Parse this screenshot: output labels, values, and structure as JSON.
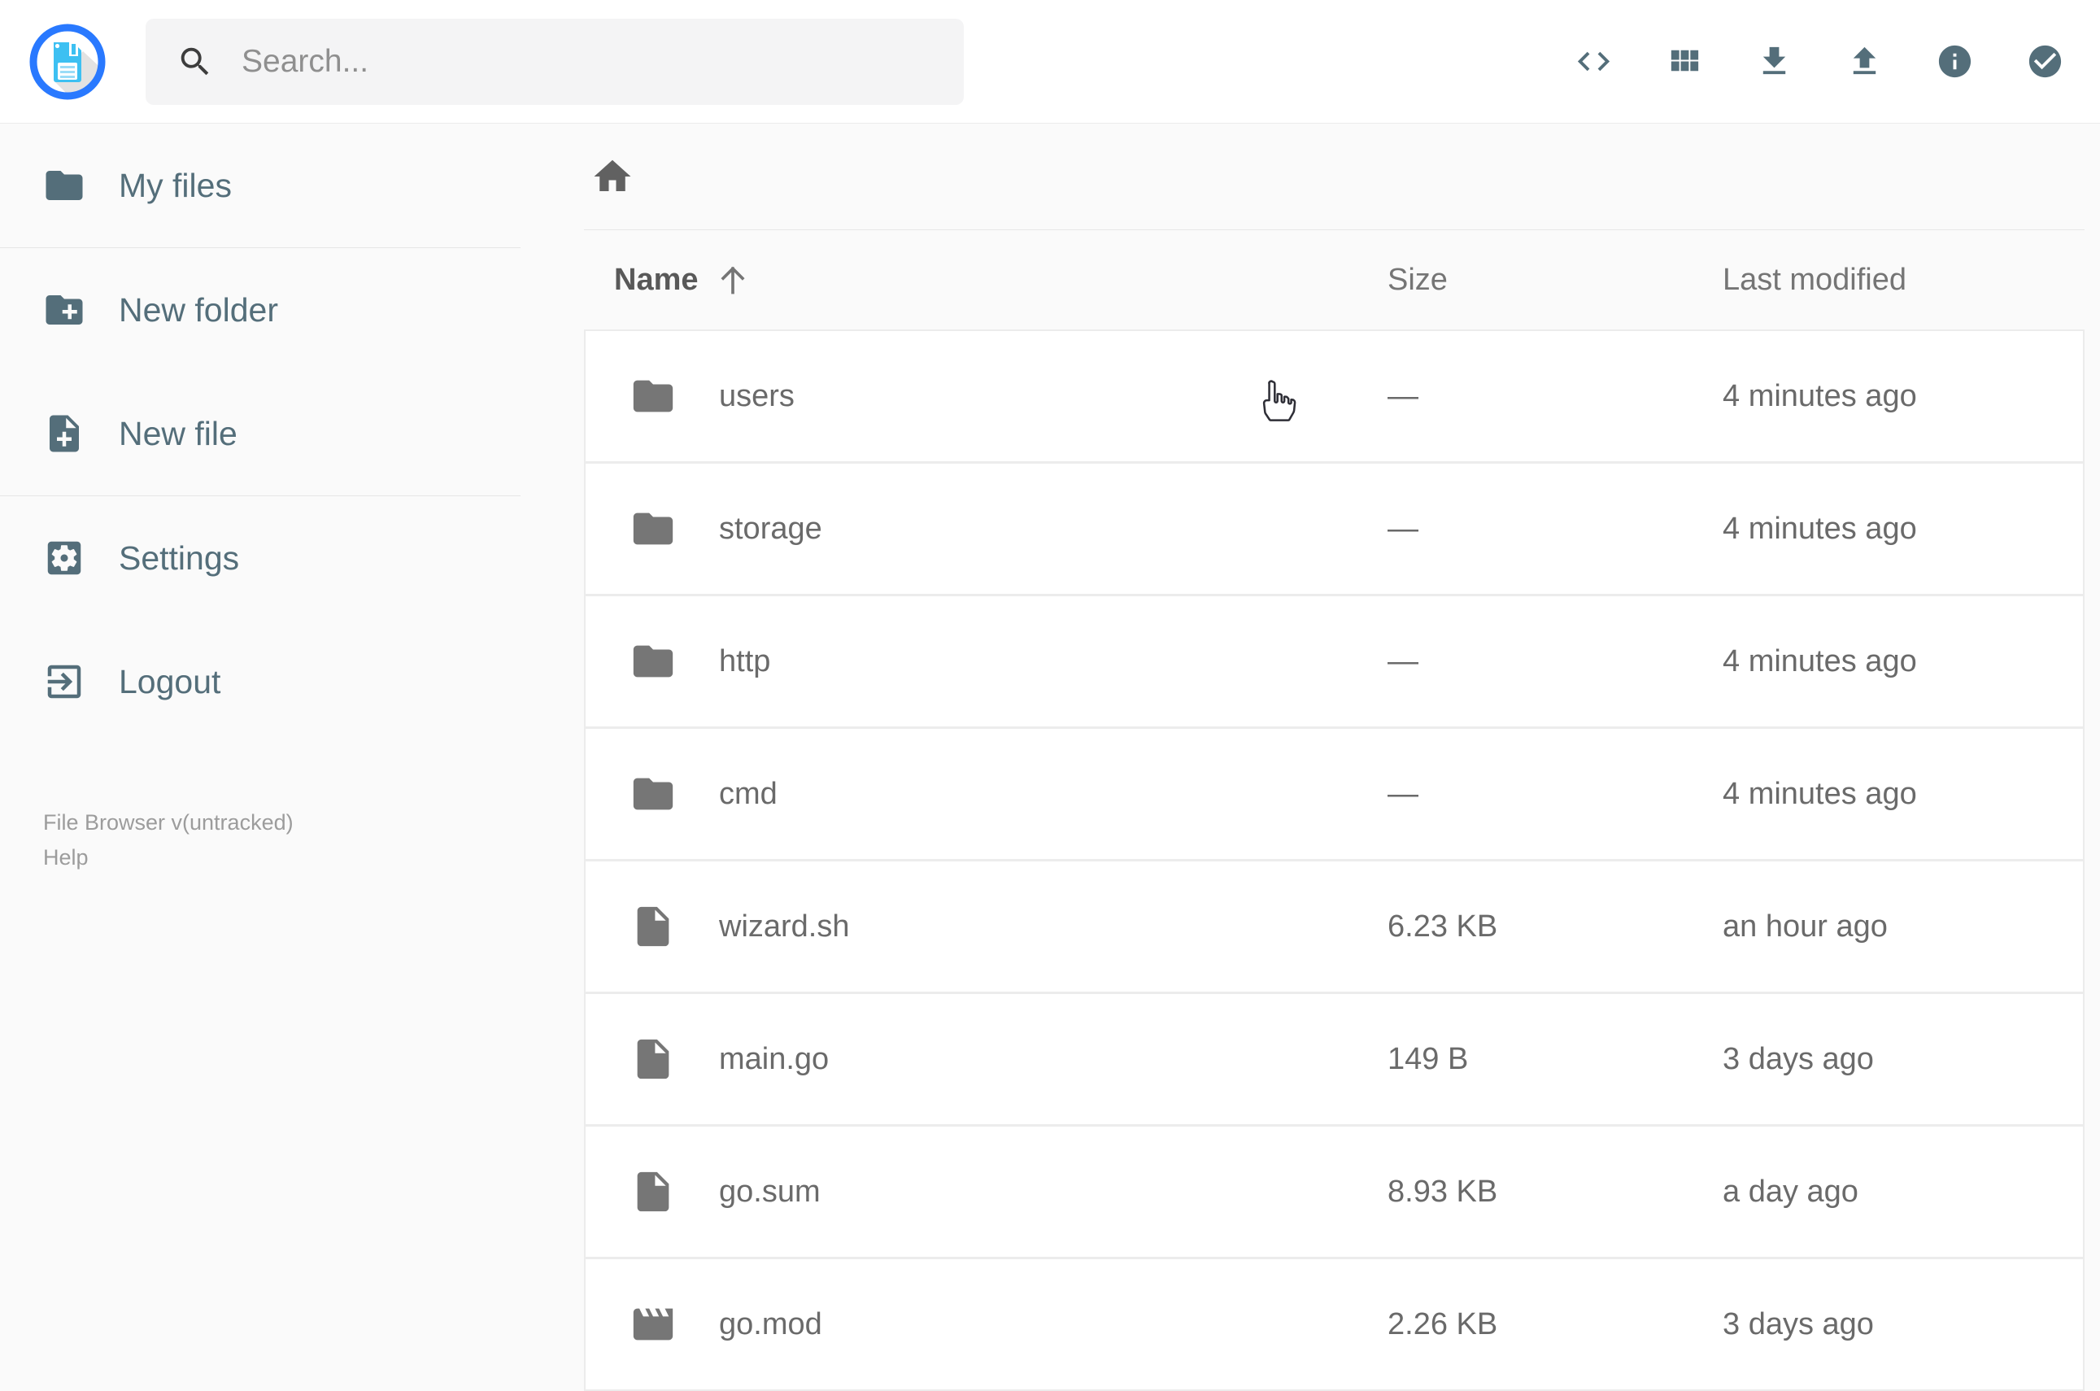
{
  "header": {
    "search_placeholder": "Search...",
    "actions": [
      {
        "label": "Switch view",
        "icon": "code-icon"
      },
      {
        "label": "Switch view mode",
        "icon": "grid-view-icon"
      },
      {
        "label": "Download",
        "icon": "download-icon"
      },
      {
        "label": "Upload",
        "icon": "upload-icon"
      },
      {
        "label": "Info",
        "icon": "info-icon"
      },
      {
        "label": "Select multiple",
        "icon": "check-circle-icon"
      }
    ]
  },
  "sidebar": {
    "items": [
      {
        "label": "My files",
        "icon": "folder-icon"
      },
      {
        "label": "New folder",
        "icon": "folder-plus-icon"
      },
      {
        "label": "New file",
        "icon": "file-plus-icon"
      },
      {
        "label": "Settings",
        "icon": "gear-icon"
      },
      {
        "label": "Logout",
        "icon": "logout-icon"
      }
    ],
    "footer": {
      "version": "File Browser v(untracked)",
      "help": "Help"
    }
  },
  "breadcrumb": {
    "home_icon": "home-icon"
  },
  "listing": {
    "columns": {
      "name": "Name",
      "size": "Size",
      "modified": "Last modified"
    },
    "sort": {
      "column": "Name",
      "direction": "ascending",
      "icon": "arrow-up-icon"
    },
    "rows": [
      {
        "name": "users",
        "icon": "folder-icon",
        "size": "—",
        "modified": "4 minutes ago"
      },
      {
        "name": "storage",
        "icon": "folder-icon",
        "size": "—",
        "modified": "4 minutes ago"
      },
      {
        "name": "http",
        "icon": "folder-icon",
        "size": "—",
        "modified": "4 minutes ago"
      },
      {
        "name": "cmd",
        "icon": "folder-icon",
        "size": "—",
        "modified": "4 minutes ago"
      },
      {
        "name": "wizard.sh",
        "icon": "file-icon",
        "size": "6.23 KB",
        "modified": "an hour ago"
      },
      {
        "name": "main.go",
        "icon": "file-icon",
        "size": "149 B",
        "modified": "3 days ago"
      },
      {
        "name": "go.sum",
        "icon": "file-icon",
        "size": "8.93 KB",
        "modified": "a day ago"
      },
      {
        "name": "go.mod",
        "icon": "movie-icon",
        "size": "2.26 KB",
        "modified": "3 days ago"
      }
    ]
  },
  "colors": {
    "accent_blue": "#2979ff",
    "logo_floppy_blue": "#3dc0f2",
    "slate_icon": "#546e7a",
    "row_text": "#6a6a6a",
    "muted_text": "#9c9c9c",
    "background": "#fafafa"
  }
}
